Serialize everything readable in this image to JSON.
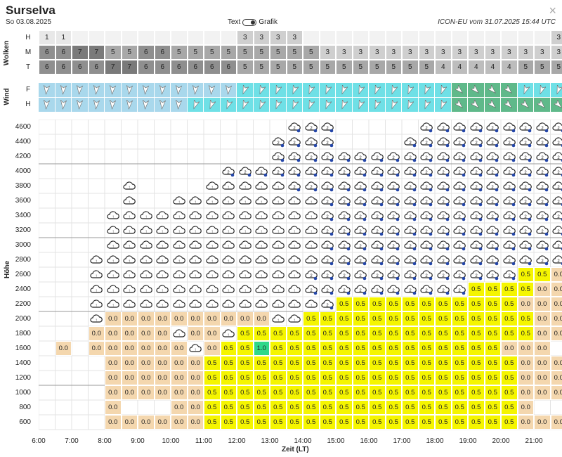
{
  "header": {
    "title": "Surselva",
    "date": "So 03.08.2025",
    "toggle_text": "Text",
    "toggle_grafik": "Grafik",
    "model": "ICON-EU vom 31.07.2025 15:44 UTC",
    "close": "×"
  },
  "clouds": {
    "label": "Wolken",
    "rows": [
      {
        "name": "H",
        "values": [
          "1",
          "1",
          "",
          "",
          "",
          "",
          "",
          "",
          "",
          "",
          "",
          "",
          "3",
          "3",
          "3",
          "3",
          "",
          "",
          "",
          "",
          "",
          "",
          "",
          "",
          "",
          "",
          "",
          "",
          "",
          "",
          "",
          "3"
        ]
      },
      {
        "name": "M",
        "values": [
          "6",
          "6",
          "7",
          "7",
          "5",
          "5",
          "6",
          "6",
          "5",
          "5",
          "5",
          "5",
          "5",
          "5",
          "5",
          "5",
          "5",
          "3",
          "3",
          "3",
          "3",
          "3",
          "3",
          "3",
          "3",
          "3",
          "3",
          "3",
          "3",
          "3",
          "3",
          "3"
        ]
      },
      {
        "name": "T",
        "values": [
          "6",
          "6",
          "6",
          "6",
          "7",
          "7",
          "6",
          "6",
          "6",
          "6",
          "6",
          "6",
          "5",
          "5",
          "5",
          "5",
          "5",
          "5",
          "5",
          "5",
          "5",
          "5",
          "5",
          "5",
          "4",
          "4",
          "4",
          "4",
          "4",
          "5",
          "5",
          "5"
        ]
      }
    ]
  },
  "wind": {
    "label": "Wind",
    "rows": [
      {
        "name": "F",
        "colors": [
          "b",
          "b",
          "b",
          "b",
          "b",
          "b",
          "b",
          "b",
          "b",
          "b",
          "b",
          "b",
          "c",
          "c",
          "c",
          "c",
          "c",
          "c",
          "c",
          "c",
          "c",
          "c",
          "c",
          "c",
          "c",
          "g",
          "g",
          "g",
          "g",
          "c",
          "c",
          "c"
        ]
      },
      {
        "name": "H",
        "colors": [
          "b",
          "b",
          "b",
          "b",
          "b",
          "b",
          "b",
          "b",
          "b",
          "c",
          "c",
          "c",
          "c",
          "c",
          "c",
          "c",
          "c",
          "c",
          "c",
          "c",
          "c",
          "c",
          "c",
          "c",
          "c",
          "g",
          "g",
          "g",
          "g",
          "g",
          "g",
          "g"
        ]
      }
    ]
  },
  "chart": {
    "y_title": "Höhe",
    "x_title": "Zeit (LT)",
    "y_ticks": [
      "4600",
      "4400",
      "4200",
      "4000",
      "3800",
      "3600",
      "3400",
      "3200",
      "3000",
      "2800",
      "2600",
      "2400",
      "2200",
      "2000",
      "1800",
      "1600",
      "1400",
      "1200",
      "1000",
      "800",
      "600"
    ],
    "x_ticks": [
      "6:00",
      "7:00",
      "8:00",
      "9:00",
      "10:00",
      "11:00",
      "12:00",
      "13:00",
      "14:00",
      "15:00",
      "16:00",
      "17:00",
      "18:00",
      "19:00",
      "20:00",
      "21:00"
    ]
  },
  "colors": {
    "empty": "#f4d7ae",
    "yellow": "#f5f500",
    "green": "#2fd88a",
    "blue": "#a9d8ec",
    "cyan": "#6fe0e6",
    "teal": "#5fb98a"
  },
  "chart_data": {
    "type": "heatmap",
    "row_altitudes": [
      4600,
      4400,
      4200,
      4000,
      3800,
      3600,
      3400,
      3200,
      3000,
      2800,
      2600,
      2400,
      2200,
      2000,
      1800,
      1600,
      1400,
      1200,
      1000,
      800,
      600
    ],
    "col_count": 32,
    "rows": [
      "...............rrr.....rrrrrrrrr....",
      "..............rrrr....rrrrrrrrrr....",
      "..............rrrrrrrrrrrrrrrrrr....",
      "...........rrrrrrrrrrrrrrrrrrrrr....",
      ".....o....ooooorrrrrrrrrrrrrrrrr....",
      ".....o..ooooooooorrrrrrrrrrrrrrr....",
      "....ooooooooooooorrrrrrrrrrrrrrrrr..",
      "....ooooooooooooorrrrrrrrrrrrrrrrr..",
      "....ooooooooooooorrrrrrrrrrrrrrrrr..",
      "...oooooooooooooorrrrrrrrrrrrrrrrEr.",
      "...ooooooooooooorrrrrrrrrrrrrYYEEE..",
      "...ooooooooooooorrrrrrrrrrYYYYEEE.E.",
      "...oooooooooooooorYYYYYYYYYYYEEE..E.",
      "...oEEEEEEEEEEooYYYYYYYYYYYYYYEEEEE.",
      "...EEEEEoEEoYYYYYYYYYYYYYYYYYYEEE...",
      ".E.EEEEEEoEYYGYYYYYYYYYYYYYYEEE...E.",
      "....EEEEEEYYYYYYYYYYYYYYYYYYYEEEEEEE",
      "....EEEEEEYYYYYYYYYYYYYYYYYYYEEE....",
      "....EEEEEEYYYYYYYYYYYYYYYYYYYEEEEEEE",
      "....E...EEYYYYYYYYYYYYYYYYYYYE......",
      "....EEEEEEYYYYYYYYYYYYYYYYYYYEEE...."
    ]
  }
}
